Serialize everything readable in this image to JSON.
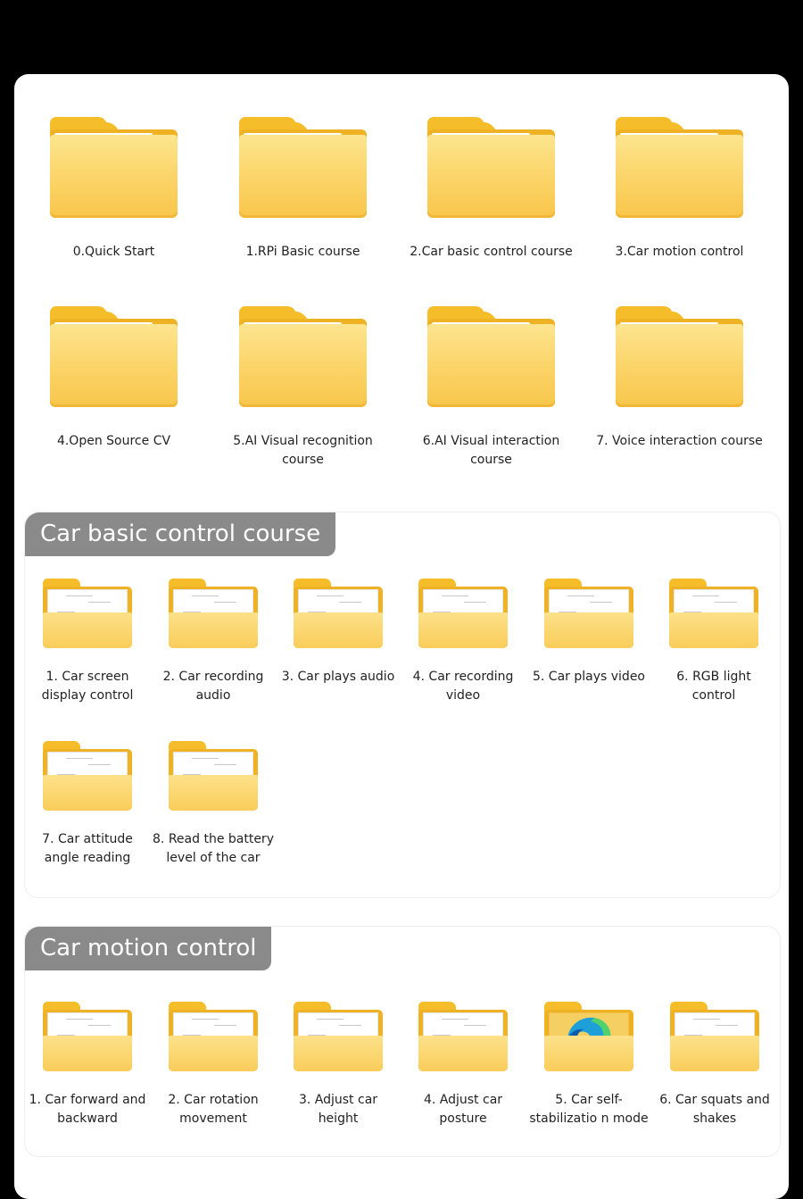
{
  "top_folders": [
    {
      "label": "0.Quick Start"
    },
    {
      "label": "1.RPi Basic course"
    },
    {
      "label": "2.Car basic control course"
    },
    {
      "label": "3.Car motion control"
    },
    {
      "label": "4.Open Source CV"
    },
    {
      "label": "5.AI Visual recognition course"
    },
    {
      "label": "6.AI Visual interaction course"
    },
    {
      "label": "7. Voice interaction course"
    }
  ],
  "section_basic": {
    "title": "Car basic control course",
    "items": [
      {
        "label": "1. Car screen display control"
      },
      {
        "label": "2. Car recording audio"
      },
      {
        "label": "3. Car plays audio"
      },
      {
        "label": "4. Car recording video"
      },
      {
        "label": "5. Car plays video"
      },
      {
        "label": "6. RGB light control"
      },
      {
        "label": "7. Car attitude angle reading"
      },
      {
        "label": "8. Read the battery level of the car"
      }
    ]
  },
  "section_motion": {
    "title": "Car motion control",
    "items": [
      {
        "label": "1. Car forward and backward"
      },
      {
        "label": "2. Car rotation movement"
      },
      {
        "label": "3. Adjust car height"
      },
      {
        "label": "4. Adjust car posture"
      },
      {
        "label": "5. Car self-stabilizatio n mode",
        "icon": "edge-browser-icon"
      },
      {
        "label": "6. Car squats and shakes"
      }
    ]
  },
  "colors": {
    "background": "#000000",
    "folder_yellow": "#fbd366",
    "folder_dark": "#f0b225",
    "section_title_bg": "#8a8a8a"
  }
}
